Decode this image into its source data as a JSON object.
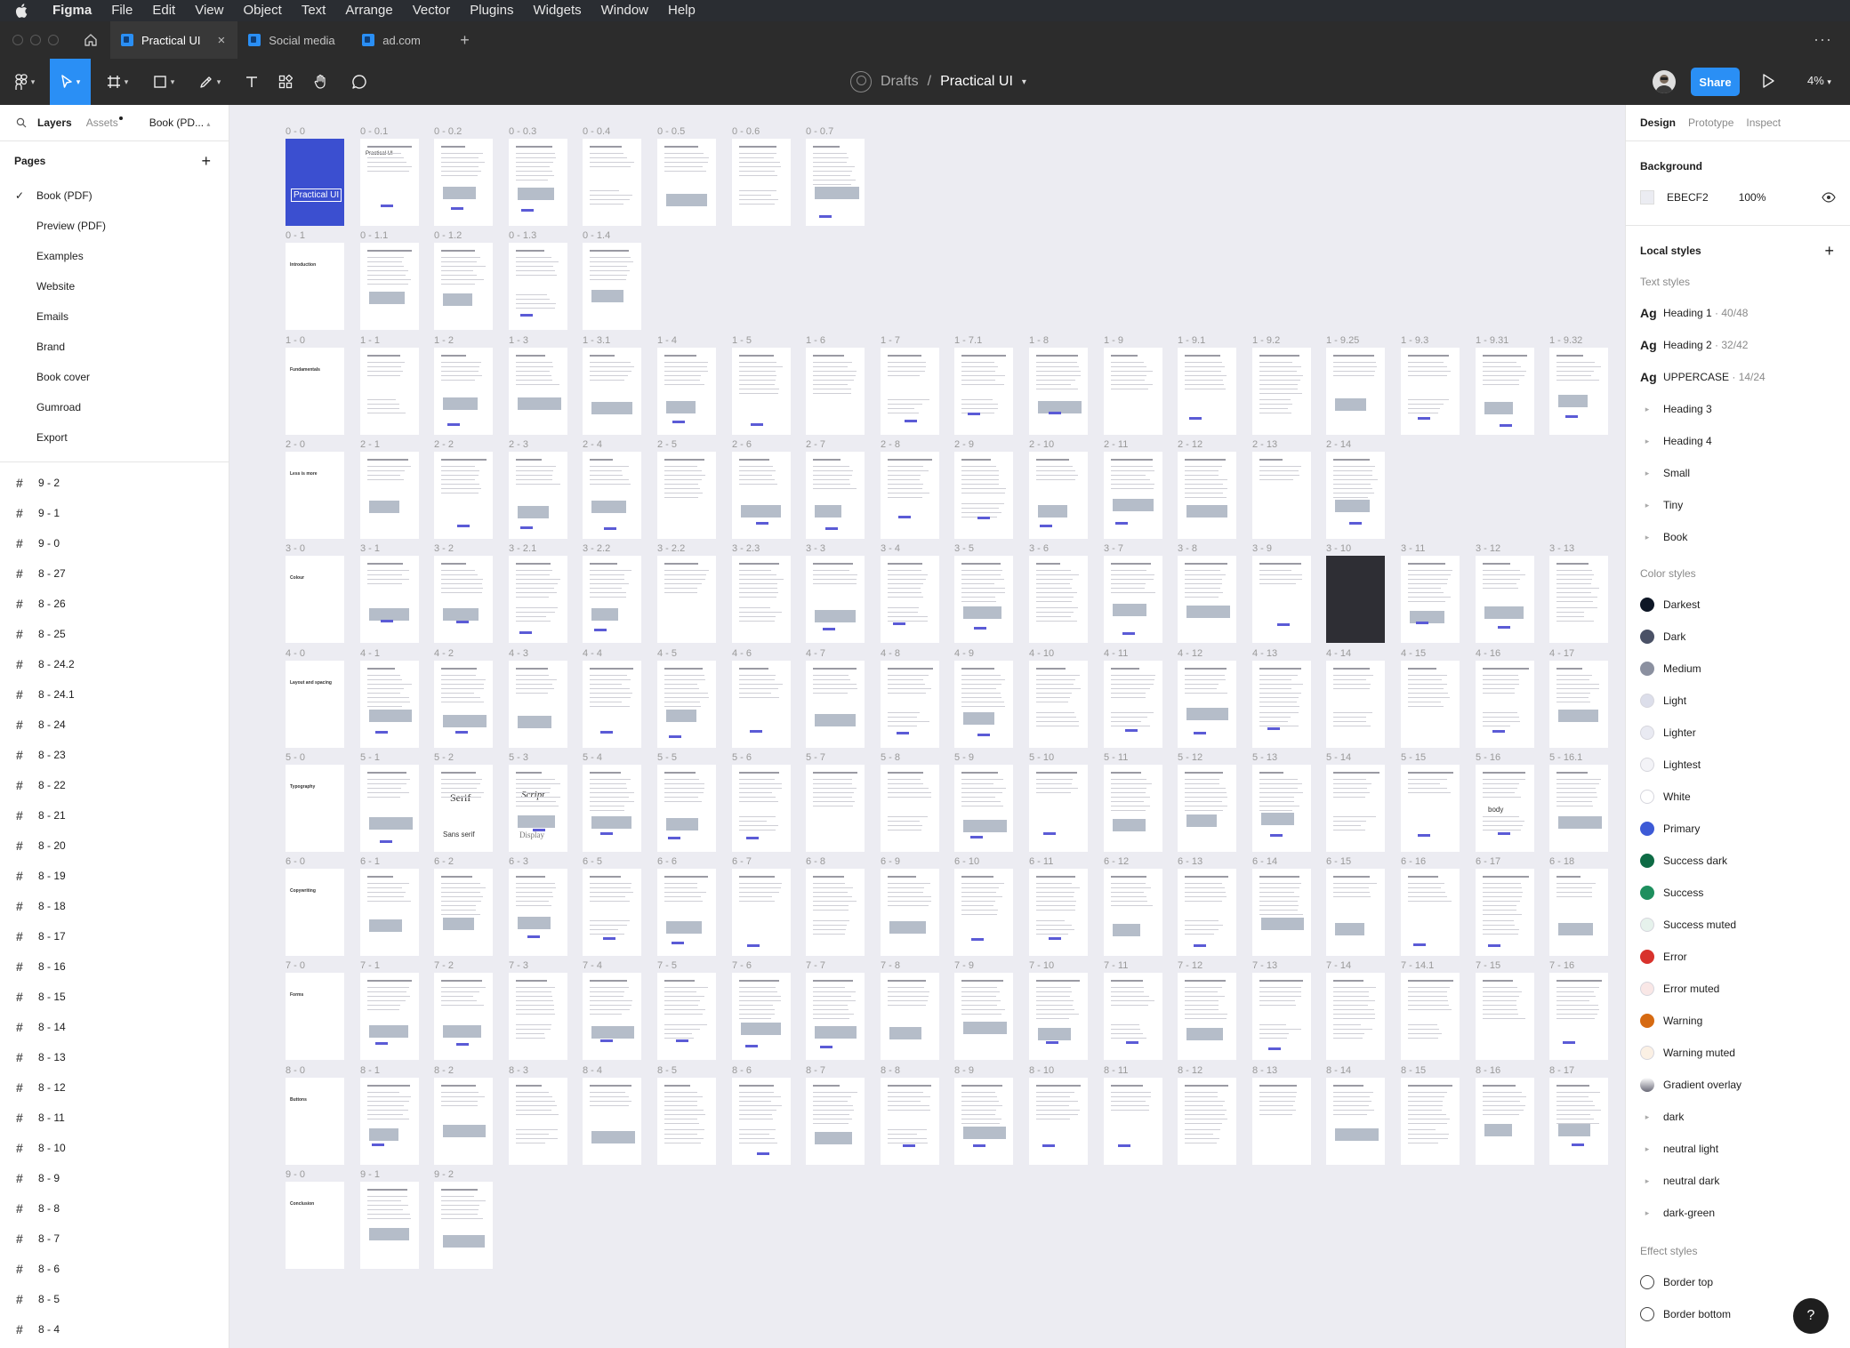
{
  "menubar": {
    "app": "Figma",
    "items": [
      "File",
      "Edit",
      "View",
      "Object",
      "Text",
      "Arrange",
      "Vector",
      "Plugins",
      "Widgets",
      "Window",
      "Help"
    ]
  },
  "tabs": [
    {
      "label": "Practical UI",
      "active": true
    },
    {
      "label": "Social media",
      "active": false
    },
    {
      "label": "ad.com",
      "active": false
    }
  ],
  "toolbar": {
    "project": "Drafts",
    "separator": "/",
    "file_title": "Practical UI",
    "share_label": "Share",
    "zoom": "4%"
  },
  "left_panel": {
    "tabs": {
      "layers": "Layers",
      "assets": "Assets",
      "page": "Book (PD..."
    },
    "pages_title": "Pages",
    "pages": [
      "Book (PDF)",
      "Preview (PDF)",
      "Examples",
      "Website",
      "Emails",
      "Brand",
      "Book cover",
      "Gumroad",
      "Export"
    ],
    "current_page": "Book (PDF)",
    "layers": [
      "9 - 2",
      "9 - 1",
      "9 - 0",
      "8 - 27",
      "8 - 26",
      "8 - 25",
      "8 - 24.2",
      "8 - 24.1",
      "8 - 24",
      "8 - 23",
      "8 - 22",
      "8 - 21",
      "8 - 20",
      "8 - 19",
      "8 - 18",
      "8 - 17",
      "8 - 16",
      "8 - 15",
      "8 - 14",
      "8 - 13",
      "8 - 12",
      "8 - 11",
      "8 - 10",
      "8 - 9",
      "8 - 8",
      "8 - 7",
      "8 - 6",
      "8 - 5",
      "8 - 4"
    ]
  },
  "right_panel": {
    "tabs": {
      "design": "Design",
      "prototype": "Prototype",
      "inspect": "Inspect"
    },
    "background_title": "Background",
    "background_hex": "EBECF2",
    "background_opacity": "100%",
    "local_styles_title": "Local styles",
    "text_styles_title": "Text styles",
    "text_styles": [
      {
        "name": "Heading 1",
        "meta": " · 40/48",
        "kind": "style"
      },
      {
        "name": "Heading 2",
        "meta": " · 32/42",
        "kind": "style"
      },
      {
        "name": "UPPERCASE",
        "meta": " · 14/24",
        "kind": "style"
      },
      {
        "name": "Heading 3",
        "meta": "",
        "kind": "group"
      },
      {
        "name": "Heading 4",
        "meta": "",
        "kind": "group"
      },
      {
        "name": "Small",
        "meta": "",
        "kind": "group"
      },
      {
        "name": "Tiny",
        "meta": "",
        "kind": "group"
      },
      {
        "name": "Book",
        "meta": "",
        "kind": "group"
      }
    ],
    "color_styles_title": "Color styles",
    "color_styles": [
      {
        "name": "Darkest",
        "color": "#0E1726",
        "kind": "style"
      },
      {
        "name": "Dark",
        "color": "#4A5166",
        "kind": "style"
      },
      {
        "name": "Medium",
        "color": "#8B90A0",
        "kind": "style"
      },
      {
        "name": "Light",
        "color": "#DCDEEA",
        "kind": "style"
      },
      {
        "name": "Lighter",
        "color": "#E9EAF2",
        "kind": "style"
      },
      {
        "name": "Lightest",
        "color": "#F3F3F7",
        "kind": "style"
      },
      {
        "name": "White",
        "color": "#FFFFFF",
        "kind": "style"
      },
      {
        "name": "Primary",
        "color": "#3D5AD6",
        "kind": "style"
      },
      {
        "name": "Success dark",
        "color": "#0E6B45",
        "kind": "style"
      },
      {
        "name": "Success",
        "color": "#1E8F5E",
        "kind": "style"
      },
      {
        "name": "Success muted",
        "color": "#E6F2EC",
        "kind": "style"
      },
      {
        "name": "Error",
        "color": "#D8322C",
        "kind": "style"
      },
      {
        "name": "Error muted",
        "color": "#F9E7E6",
        "kind": "style"
      },
      {
        "name": "Warning",
        "color": "#D66A12",
        "kind": "style"
      },
      {
        "name": "Warning muted",
        "color": "#FBF0E4",
        "kind": "style"
      },
      {
        "name": "Gradient overlay",
        "color": "#9A9AA6",
        "kind": "style"
      },
      {
        "name": "dark",
        "color": "",
        "kind": "group"
      },
      {
        "name": "neutral light",
        "color": "",
        "kind": "group"
      },
      {
        "name": "neutral dark",
        "color": "",
        "kind": "group"
      },
      {
        "name": "dark-green",
        "color": "",
        "kind": "group"
      }
    ],
    "effect_styles_title": "Effect styles",
    "effect_styles": [
      "Border top",
      "Border bottom"
    ]
  },
  "canvas": {
    "rows": [
      [
        "0 - 0",
        "0 - 0.1",
        "0 - 0.2",
        "0 - 0.3",
        "0 - 0.4",
        "0 - 0.5",
        "0 - 0.6",
        "0 - 0.7"
      ],
      [
        "0 - 1",
        "0 - 1.1",
        "0 - 1.2",
        "0 - 1.3",
        "0 - 1.4"
      ],
      [
        "1 - 0",
        "1 - 1",
        "1 - 2",
        "1 - 3",
        "1 - 3.1",
        "1 - 4",
        "1 - 5",
        "1 - 6",
        "1 - 7",
        "1 - 7.1",
        "1 - 8",
        "1 - 9",
        "1 - 9.1",
        "1 - 9.2",
        "1 - 9.25",
        "1 - 9.3",
        "1 - 9.31",
        "1 - 9.32"
      ],
      [
        "2 - 0",
        "2 - 1",
        "2 - 2",
        "2 - 3",
        "2 - 4",
        "2 - 5",
        "2 - 6",
        "2 - 7",
        "2 - 8",
        "2 - 9",
        "2 - 10",
        "2 - 11",
        "2 - 12",
        "2 - 13",
        "2 - 14"
      ],
      [
        "3 - 0",
        "3 - 1",
        "3 - 2",
        "3 - 2.1",
        "3 - 2.2",
        "3 - 2.2",
        "3 - 2.3",
        "3 - 3",
        "3 - 4",
        "3 - 5",
        "3 - 6",
        "3 - 7",
        "3 - 8",
        "3 - 9",
        "3 - 10",
        "3 - 11",
        "3 - 12",
        "3 - 13"
      ],
      [
        "4 - 0",
        "4 - 1",
        "4 - 2",
        "4 - 3",
        "4 - 4",
        "4 - 5",
        "4 - 6",
        "4 - 7",
        "4 - 8",
        "4 - 9",
        "4 - 10",
        "4 - 11",
        "4 - 12",
        "4 - 13",
        "4 - 14",
        "4 - 15",
        "4 - 16",
        "4 - 17"
      ],
      [
        "5 - 0",
        "5 - 1",
        "5 - 2",
        "5 - 3",
        "5 - 4",
        "5 - 5",
        "5 - 6",
        "5 - 7",
        "5 - 8",
        "5 - 9",
        "5 - 10",
        "5 - 11",
        "5 - 12",
        "5 - 13",
        "5 - 14",
        "5 - 15",
        "5 - 16",
        "5 - 16.1"
      ],
      [
        "6 - 0",
        "6 - 1",
        "6 - 2",
        "6 - 3",
        "6 - 5",
        "6 - 6",
        "6 - 7",
        "6 - 8",
        "6 - 9",
        "6 - 10",
        "6 - 11",
        "6 - 12",
        "6 - 13",
        "6 - 14",
        "6 - 15",
        "6 - 16",
        "6 - 17",
        "6 - 18"
      ],
      [
        "7 - 0",
        "7 - 1",
        "7 - 2",
        "7 - 3",
        "7 - 4",
        "7 - 5",
        "7 - 6",
        "7 - 7",
        "7 - 8",
        "7 - 9",
        "7 - 10",
        "7 - 11",
        "7 - 12",
        "7 - 13",
        "7 - 14",
        "7 - 14.1",
        "7 - 15",
        "7 - 16"
      ],
      [
        "8 - 0",
        "8 - 1",
        "8 - 2",
        "8 - 3",
        "8 - 4",
        "8 - 5",
        "8 - 6",
        "8 - 7",
        "8 - 8",
        "8 - 9",
        "8 - 10",
        "8 - 11",
        "8 - 12",
        "8 - 13",
        "8 - 14",
        "8 - 15",
        "8 - 16",
        "8 - 17"
      ],
      [
        "9 - 0",
        "9 - 1",
        "9 - 2"
      ]
    ],
    "cover_title": "Practical UI",
    "section_titles": [
      "Introduction",
      "Fundamentals",
      "Less is more",
      "Colour",
      "Layout and spacing",
      "Typography",
      "Copywriting",
      "Forms",
      "Buttons",
      "Conclusion"
    ],
    "page_title": "Practical UI",
    "type_samples": {
      "serif": "Serif",
      "script": "Script",
      "sans_serif": "Sans serif",
      "display": "Display",
      "body": "body"
    }
  }
}
